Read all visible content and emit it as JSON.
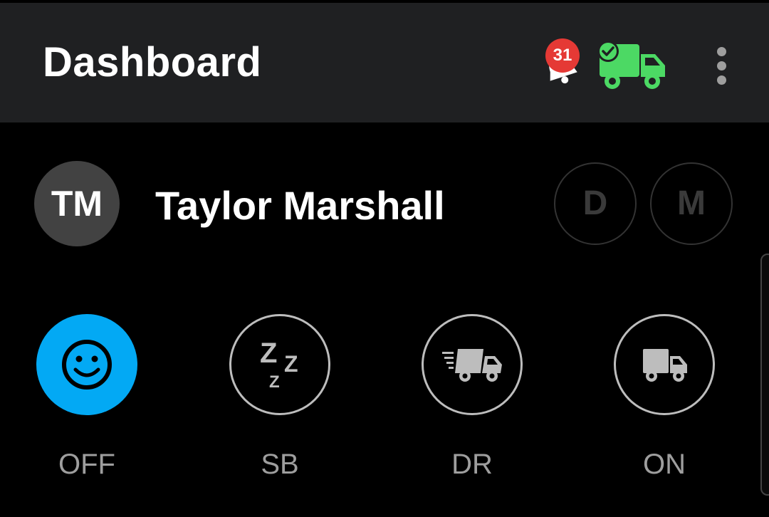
{
  "app_bar": {
    "title": "Dashboard",
    "notification_count": "31",
    "background_color": "#1f2022"
  },
  "icons": {
    "notification": "bell-icon",
    "truck_status": "truck-check-icon",
    "menu": "more-vert-icon"
  },
  "driver": {
    "initials": "TM",
    "name": "Taylor Marshall"
  },
  "modes": [
    {
      "label": "D"
    },
    {
      "label": "M"
    }
  ],
  "duty_statuses": [
    {
      "label": "OFF",
      "icon": "smiley-icon",
      "active": true
    },
    {
      "label": "SB",
      "icon": "sleep-icon",
      "active": false
    },
    {
      "label": "DR",
      "icon": "driving-truck-icon",
      "active": false
    },
    {
      "label": "ON",
      "icon": "truck-icon",
      "active": false
    }
  ],
  "colors": {
    "active_status": "#03a9f4",
    "badge": "#e53935",
    "truck_ok": "#4cd964",
    "inactive": "#bdbdbd"
  }
}
